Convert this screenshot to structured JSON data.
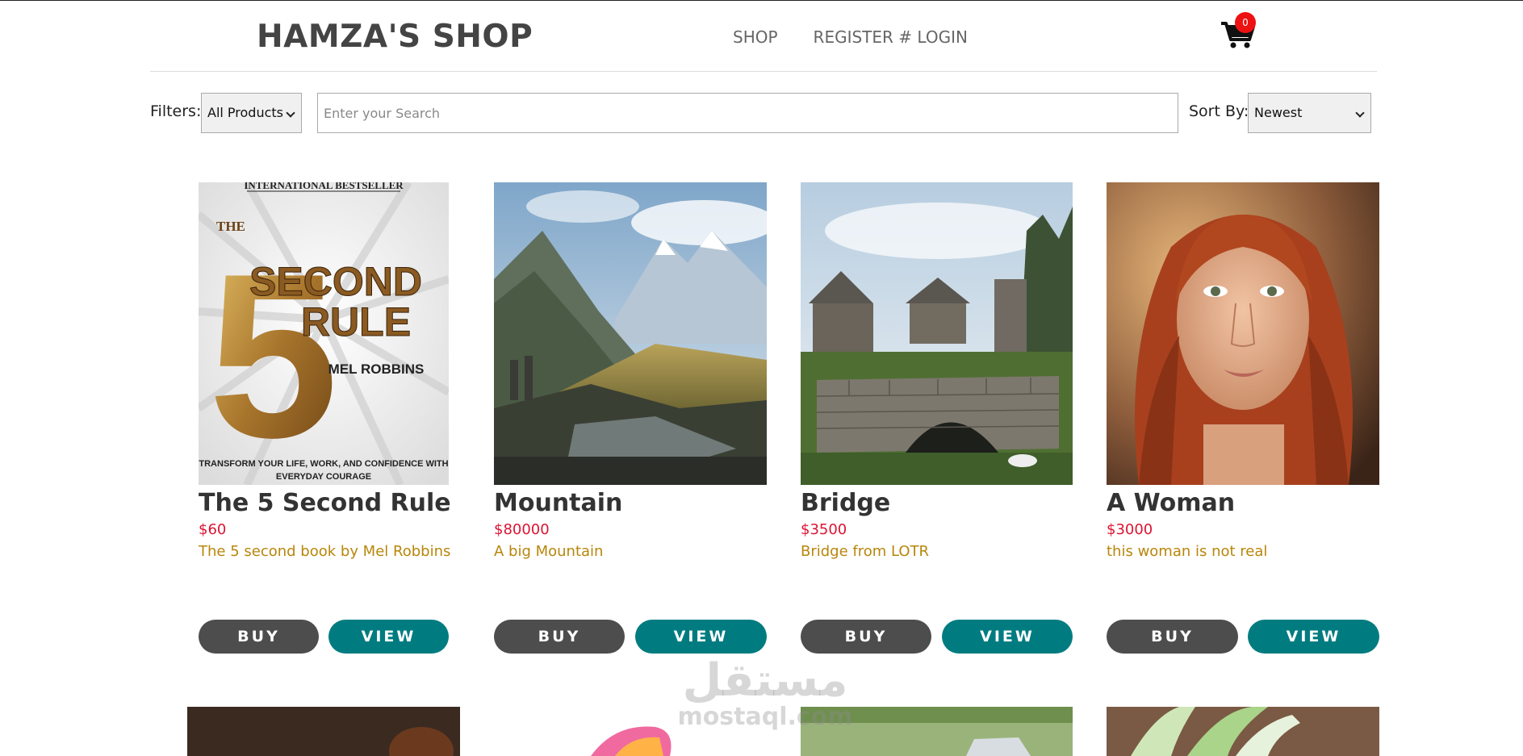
{
  "header": {
    "logo": "HAMZA'S SHOP",
    "nav": [
      "SHOP",
      "REGISTER # LOGIN"
    ],
    "cart_count": "0"
  },
  "filters": {
    "label": "Filters:",
    "selected": "All Products",
    "search_placeholder": "Enter your Search",
    "sort_label": "Sort By:",
    "sort_selected": "Newest"
  },
  "buttons": {
    "buy": "BUY",
    "view": "VIEW"
  },
  "products": [
    {
      "name": "The 5 Second Rule",
      "price": "$60",
      "description": "The 5 second book by Mel Robbins",
      "cover": {
        "top": "INTERNATIONAL BESTSELLER",
        "the": "THE",
        "number": "5",
        "line1": "SECOND",
        "line2": "RULE",
        "author": "MEL ROBBINS",
        "tagline1": "TRANSFORM YOUR LIFE, WORK, AND CONFIDENCE WITH",
        "tagline2": "EVERYDAY COURAGE"
      }
    },
    {
      "name": "Mountain",
      "price": "$80000",
      "description": "A big Mountain"
    },
    {
      "name": "Bridge",
      "price": "$3500",
      "description": "Bridge from LOTR"
    },
    {
      "name": "A Woman",
      "price": "$3000",
      "description": "this woman is not real"
    }
  ],
  "watermark": {
    "arabic": "مستقل",
    "latin": "mostaql.com"
  },
  "colors": {
    "price": "#dc1432",
    "description": "#b8860b",
    "buy": "#4d4d4d",
    "view": "#007c80",
    "badge": "#ee1111"
  }
}
